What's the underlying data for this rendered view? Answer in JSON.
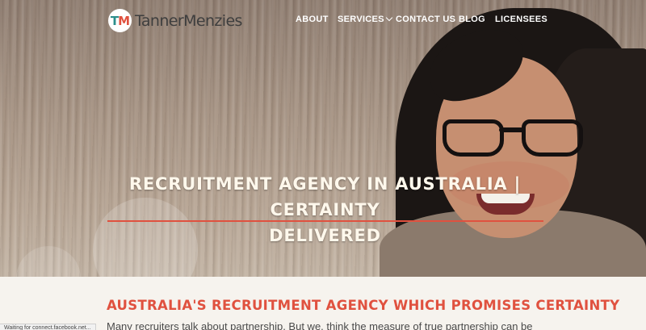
{
  "header": {
    "logo_initial_t": "T",
    "logo_initial_m": "M",
    "logo_text_part1": "Tanner",
    "logo_text_part2": "Menzies"
  },
  "nav": {
    "items": [
      {
        "label": "ABOUT"
      },
      {
        "label": "SERVICES"
      },
      {
        "label": "CONTACT US"
      },
      {
        "label": "BLOG"
      },
      {
        "label": "LICENSEES"
      }
    ]
  },
  "hero": {
    "title_line1": "RECRUITMENT AGENCY IN AUSTRALIA | CERTAINTY",
    "title_line2": "DELIVERED"
  },
  "main": {
    "heading": "AUSTRALIA'S RECRUITMENT AGENCY WHICH PROMISES CERTAINTY",
    "body_text": "Many recruiters talk about partnership. But we, think the measure of true partnership can be"
  },
  "status_bar": {
    "text": "Waiting for connect.facebook.net..."
  },
  "colors": {
    "accent": "#e0513f",
    "brand_teal": "#2c8e8b",
    "page_background": "#f6f3ee"
  }
}
